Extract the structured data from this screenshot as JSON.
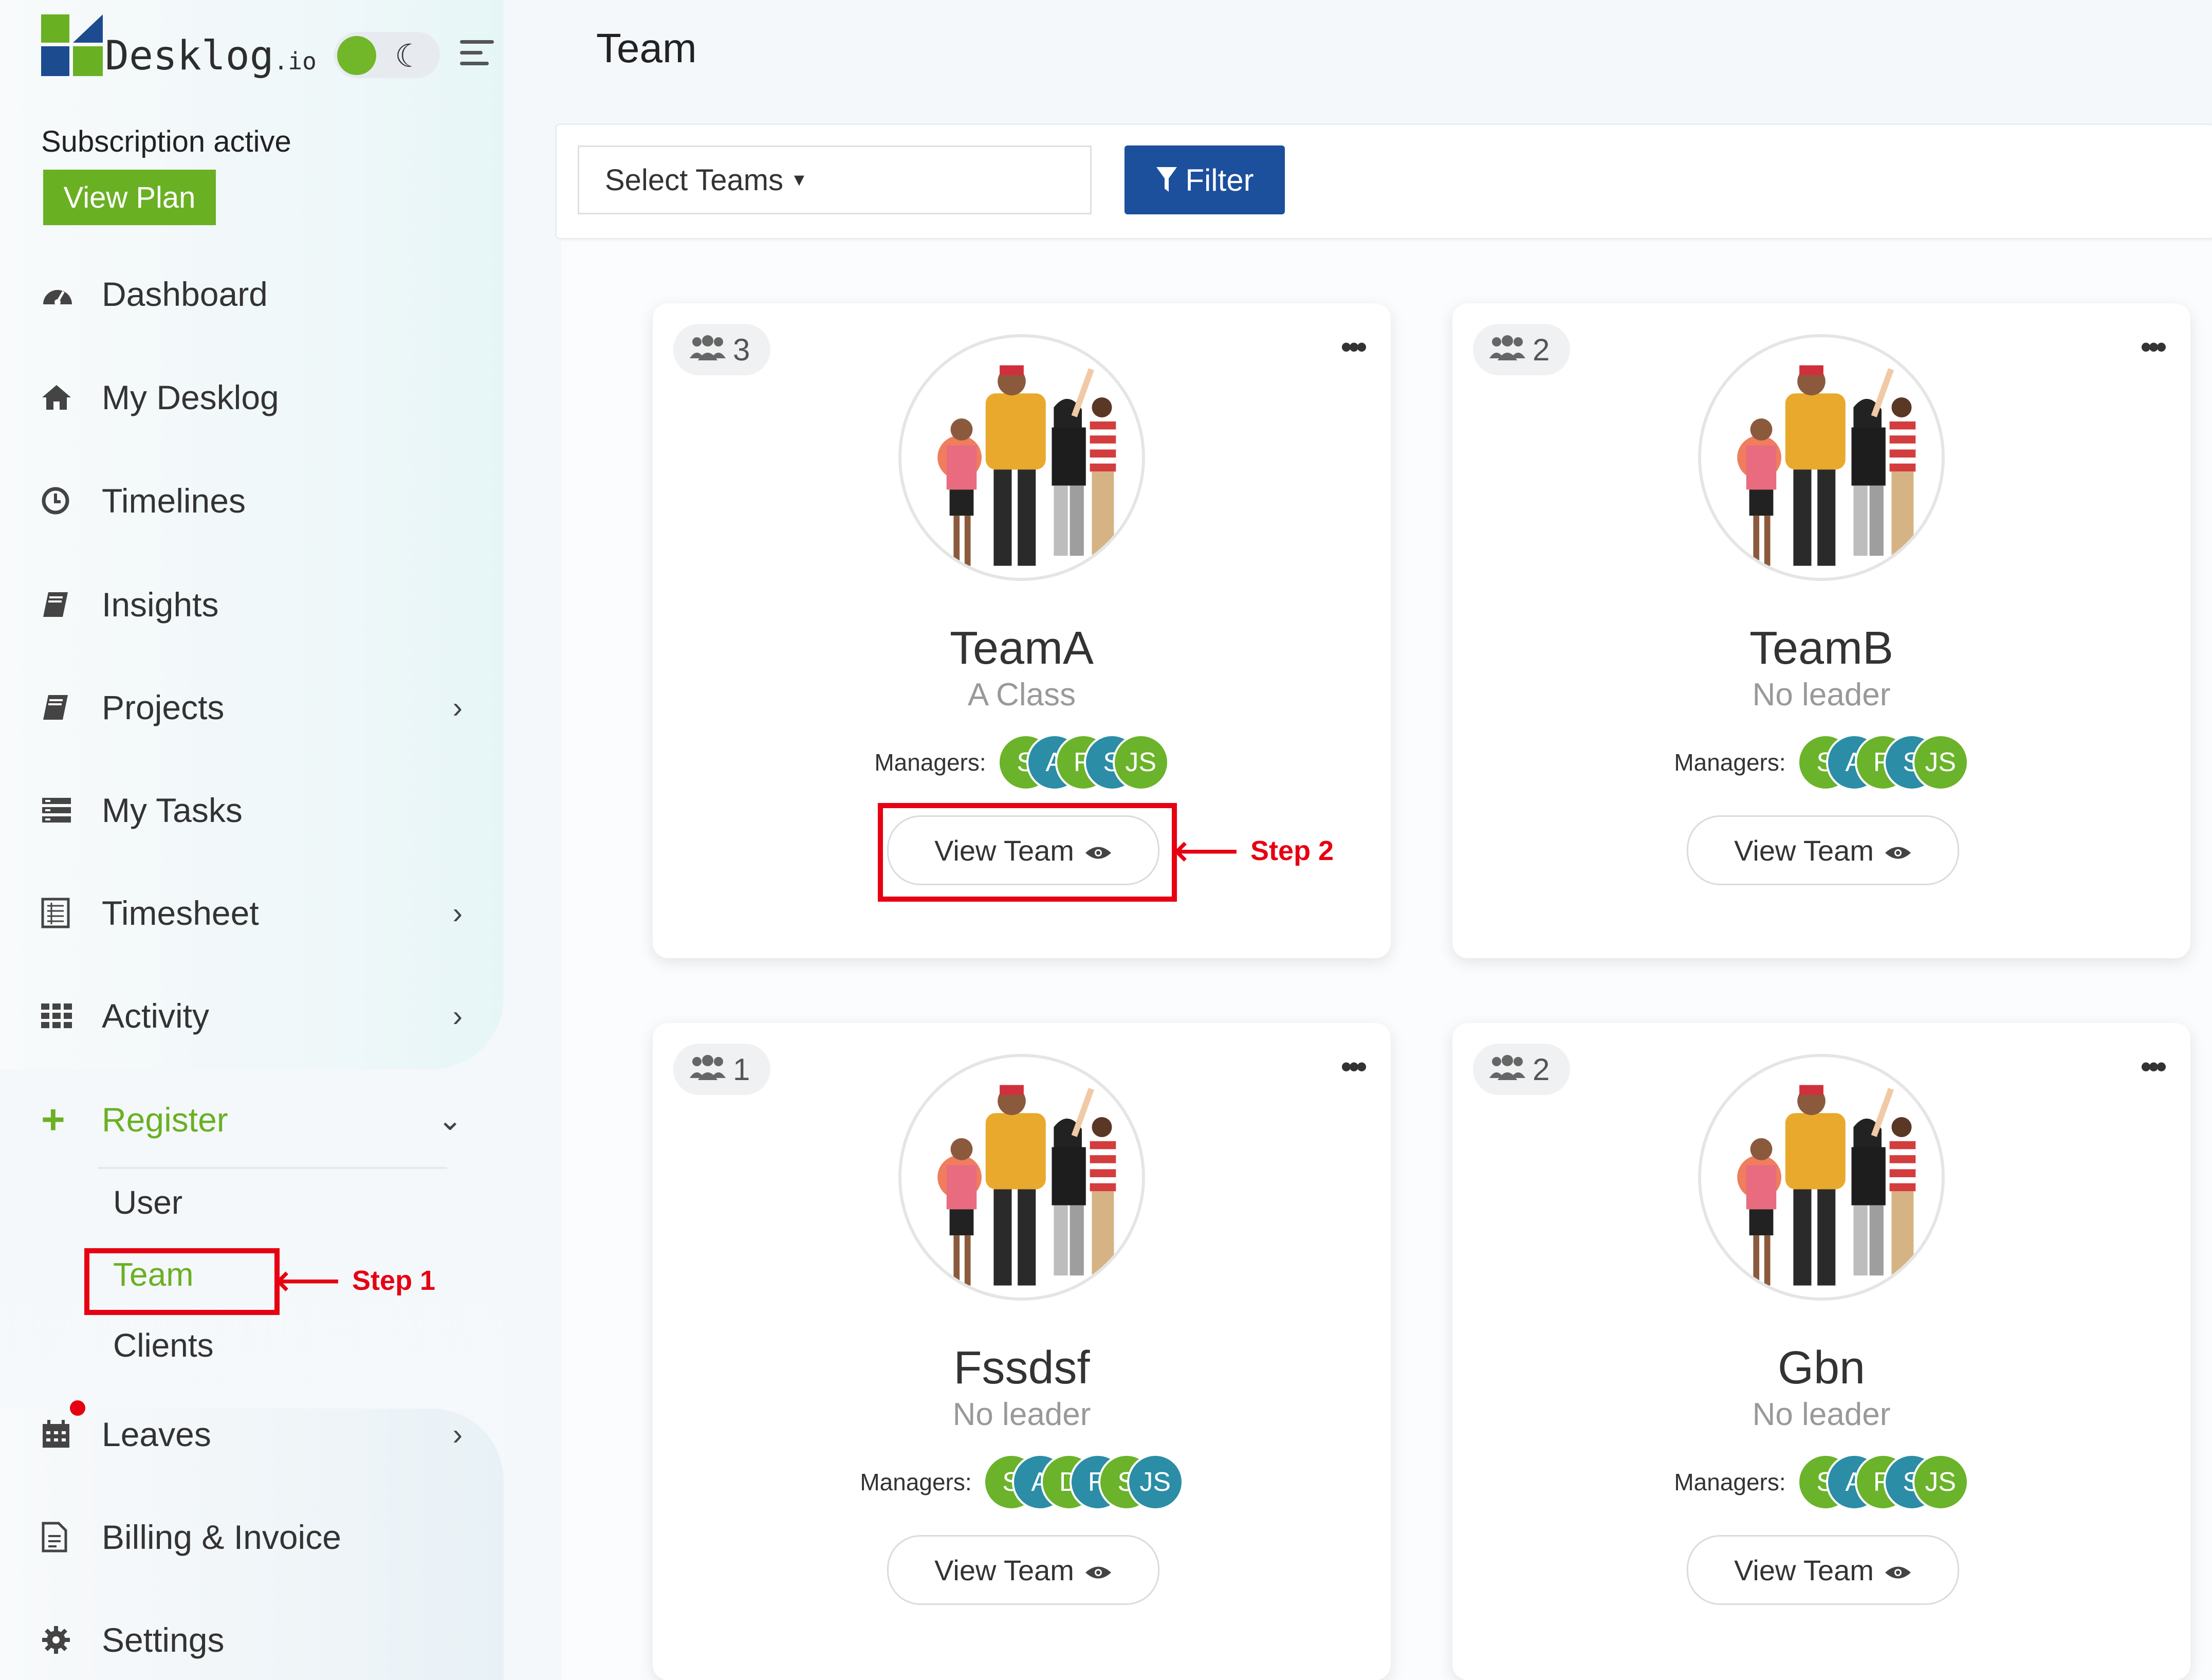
{
  "brand": {
    "name": "Desklog",
    "suffix": ".io"
  },
  "subscription": {
    "status": "Subscription active",
    "view_plan": "View Plan"
  },
  "sidebar": {
    "items": [
      {
        "label": "Dashboard",
        "icon": "dashboard-icon"
      },
      {
        "label": "My Desklog",
        "icon": "home-icon"
      },
      {
        "label": "Timelines",
        "icon": "clock-icon"
      },
      {
        "label": "Insights",
        "icon": "book-icon"
      },
      {
        "label": "Projects",
        "icon": "book-icon"
      },
      {
        "label": "My Tasks",
        "icon": "tasks-icon"
      },
      {
        "label": "Timesheet",
        "icon": "sheet-icon"
      },
      {
        "label": "Activity",
        "icon": "grid-icon"
      },
      {
        "label": "Register",
        "icon": "plus-icon"
      },
      {
        "label": "Leaves",
        "icon": "calendar-icon"
      },
      {
        "label": "Billing & Invoice",
        "icon": "invoice-icon"
      },
      {
        "label": "Settings",
        "icon": "gear-icon"
      }
    ],
    "register_sub": [
      "User",
      "Team",
      "Clients"
    ]
  },
  "page": {
    "title": "Team"
  },
  "filters": {
    "select_teams": "Select Teams",
    "filter_button": "Filter"
  },
  "teams": [
    {
      "count": "3",
      "name": "TeamA",
      "leader": "A Class",
      "managers_label": "Managers:",
      "managers": [
        "S",
        "A",
        "R",
        "S",
        "JS"
      ],
      "view_label": "View Team"
    },
    {
      "count": "2",
      "name": "TeamB",
      "leader": "No leader",
      "managers_label": "Managers:",
      "managers": [
        "S",
        "A",
        "R",
        "S",
        "JS"
      ],
      "view_label": "View Team"
    },
    {
      "count": "1",
      "name": "Fssdsf",
      "leader": "No leader",
      "managers_label": "Managers:",
      "managers": [
        "S",
        "A",
        "D",
        "R",
        "S",
        "JS"
      ],
      "view_label": "View Team"
    },
    {
      "count": "2",
      "name": "Gbn",
      "leader": "No leader",
      "managers_label": "Managers:",
      "managers": [
        "S",
        "A",
        "R",
        "S",
        "JS"
      ],
      "view_label": "View Team"
    }
  ],
  "annotations": {
    "step1": "Step 1",
    "step2": "Step 2"
  },
  "colors": {
    "accent_green": "#6ab023",
    "brand_blue": "#1c4f9c",
    "annotation_red": "#e60012"
  }
}
